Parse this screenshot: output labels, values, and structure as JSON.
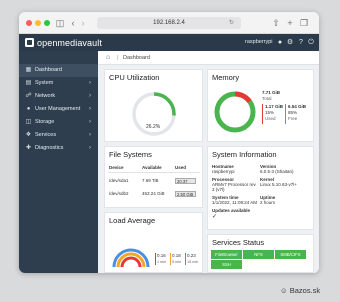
{
  "browser": {
    "url": "192.168.2.4",
    "icons": [
      "sidebar-icon",
      "back-icon",
      "forward-icon",
      "shield-icon",
      "reload-icon",
      "share-icon",
      "new-tab-icon",
      "tabs-icon"
    ]
  },
  "app": {
    "name": "openmediavault",
    "user": "raspberrypi"
  },
  "sidebar": {
    "items": [
      {
        "label": "Dashboard",
        "icon": "grid-icon",
        "active": true
      },
      {
        "label": "System",
        "icon": "monitor-icon",
        "chevron": true
      },
      {
        "label": "Network",
        "icon": "network-icon",
        "chevron": true
      },
      {
        "label": "User Management",
        "icon": "users-icon",
        "chevron": true
      },
      {
        "label": "Storage",
        "icon": "storage-icon",
        "chevron": true
      },
      {
        "label": "Services",
        "icon": "services-icon",
        "chevron": true
      },
      {
        "label": "Diagnostics",
        "icon": "diagnostics-icon",
        "chevron": true
      }
    ]
  },
  "breadcrumb": {
    "label": "Dashboard"
  },
  "cpu": {
    "title": "CPU Utilization",
    "value": "26.2%",
    "fraction": 0.262,
    "color": "#4ab44f"
  },
  "memory": {
    "title": "Memory",
    "total": "7.71 GiB",
    "total_label": "Total",
    "used": "1.17 GiB",
    "used_pct": "15%",
    "used_label": "Used",
    "free": "6.54 GiB",
    "free_pct": "85%",
    "free_label": "Free",
    "used_fraction": 0.15,
    "used_color": "#e53935",
    "free_color": "#4ab44f"
  },
  "filesystems": {
    "title": "File Systems",
    "headers": [
      "Device",
      "Available",
      "Used"
    ],
    "rows": [
      {
        "device": "/dev/sda1",
        "available": "7.69 TiB",
        "used": "20.37 GiB"
      },
      {
        "device": "/dev/sdb2",
        "available": "453.24 GiB",
        "used": "2.50 GiB"
      }
    ]
  },
  "sysinfo": {
    "title": "System Information",
    "hostname_label": "Hostname",
    "hostname": "raspberrypi",
    "version_label": "Version",
    "version": "6.0.5-3 (Shaitan)",
    "processor_label": "Processor",
    "processor": "ARMv7 Processor rev 3 (v7l)",
    "kernel_label": "Kernel",
    "kernel": "Linux 5.10.63-v7l+",
    "kernel2": "+",
    "systime_label": "System time",
    "systime": "1/1/2022, 11:09:24 AM",
    "uptime_label": "Uptime",
    "uptime": "2 hours",
    "updates_label": "Updates available",
    "updates_icon": "check-icon"
  },
  "load": {
    "title": "Load Average",
    "values": [
      {
        "value": "0.16",
        "label": "1 min"
      },
      {
        "value": "0.18",
        "label": "5 min"
      },
      {
        "value": "0.23",
        "label": "15 min"
      }
    ],
    "arc_colors": [
      "#e53935",
      "#f5a623",
      "#4a90e2"
    ]
  },
  "services": {
    "title": "Services Status",
    "items": [
      "FileBrowser",
      "NFS",
      "SMB/CIFS",
      "SSH"
    ],
    "color": "#4ab44f"
  },
  "watermark": "Bazos.sk"
}
